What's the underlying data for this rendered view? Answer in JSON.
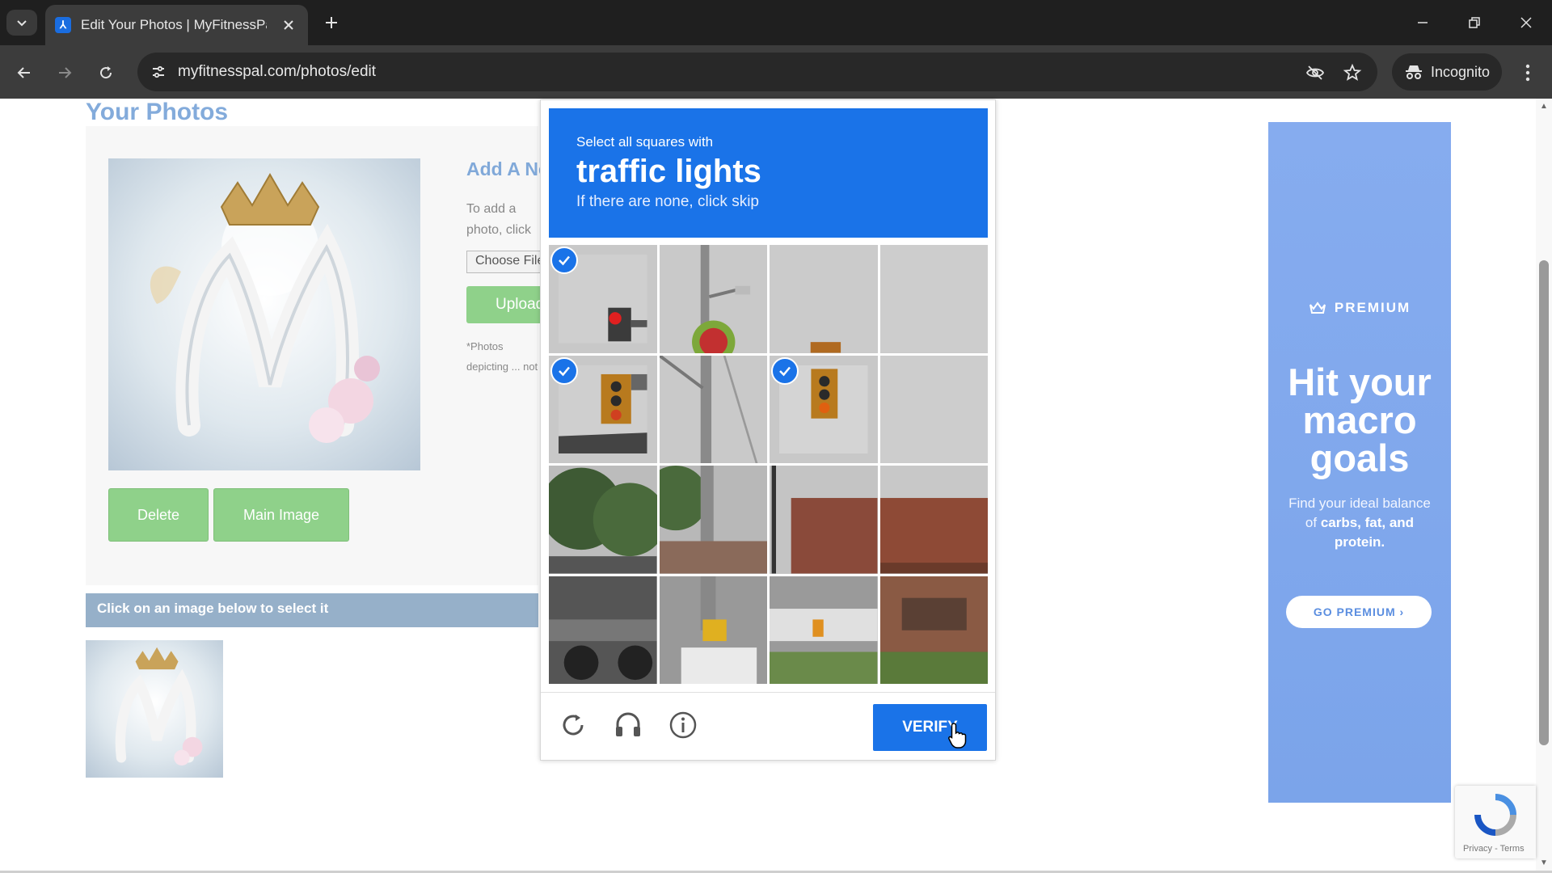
{
  "browser": {
    "tab_title": "Edit Your Photos | MyFitnessPal",
    "url": "myfitnesspal.com/photos/edit",
    "incognito_label": "Incognito"
  },
  "page": {
    "title": "Your Photos",
    "add_title": "Add A New Photo",
    "add_text": "To add a photo, click \"Upload\"",
    "choose_file_label": "Choose File",
    "upload_label": "Upload",
    "photos_note": "*Photos depicting ... not allowed.",
    "delete_label": "Delete",
    "main_image_label": "Main Image",
    "select_hint": "Click on an image below to select it"
  },
  "ad": {
    "badge": "PREMIUM",
    "headline": "Hit your macro goals",
    "body_prefix": "Find your ideal balance of ",
    "body_bold": "carbs, fat, and protein.",
    "cta": "GO PREMIUM ›"
  },
  "captcha": {
    "instruction": "Select all squares with",
    "object": "traffic lights",
    "skip_hint": "If there are none, click skip",
    "verify_label": "VERIFY",
    "selected_tiles": [
      0,
      4,
      6
    ],
    "accent": "#1a73e8"
  },
  "recaptcha_badge": {
    "terms": "Privacy - Terms"
  }
}
